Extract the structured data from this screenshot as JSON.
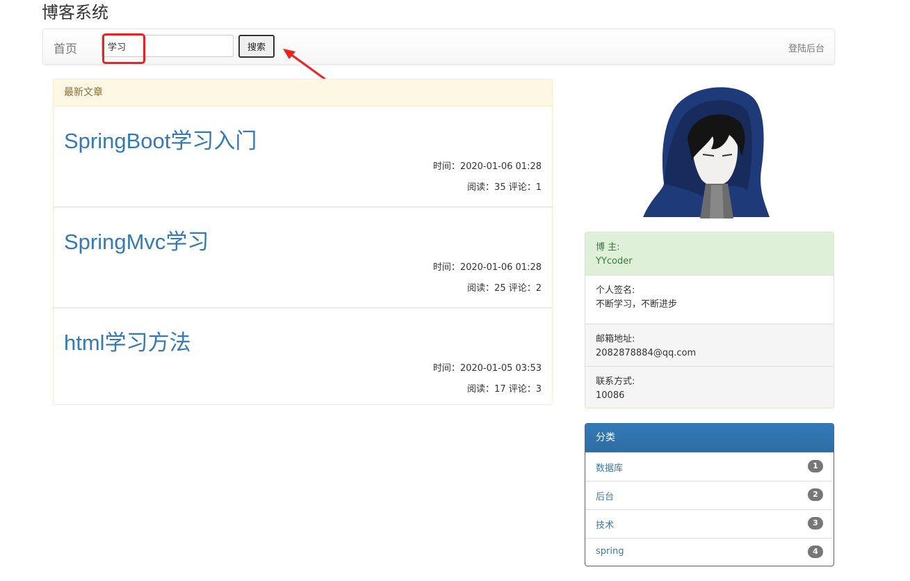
{
  "site": {
    "title": "博客系统"
  },
  "navbar": {
    "home_label": "首页",
    "search_value": "学习",
    "search_button": "搜索",
    "admin_label": "登陆后台"
  },
  "latest": {
    "heading": "最新文章",
    "articles": [
      {
        "title": "SpringBoot学习入门",
        "time": "时间：2020-01-06 01:28",
        "stats": "阅读：35 评论：1"
      },
      {
        "title": "SpringMvc学习",
        "time": "时间：2020-01-06 01:28",
        "stats": "阅读：25 评论：2"
      },
      {
        "title": "html学习方法",
        "time": "时间：2020-01-05 03:53",
        "stats": "阅读：17 评论：3"
      }
    ]
  },
  "profile": {
    "owner_label": "博 主:",
    "owner_name": "YYcoder",
    "signature_label": "个人签名:",
    "signature": "不断学习，不断进步",
    "email_label": "邮箱地址:",
    "email": "2082878884@qq.com",
    "contact_label": "联系方式:",
    "contact": "10086"
  },
  "categories": {
    "heading": "分类",
    "items": [
      {
        "label": "数据库",
        "count": "1"
      },
      {
        "label": "后台",
        "count": "2"
      },
      {
        "label": "技术",
        "count": "3"
      },
      {
        "label": "spring",
        "count": "4"
      }
    ]
  },
  "colors": {
    "link": "#337ab7",
    "warning_bg": "#fcf8e3",
    "success_bg": "#dff0d8",
    "primary": "#337ab7",
    "annotation": "#f02020"
  }
}
